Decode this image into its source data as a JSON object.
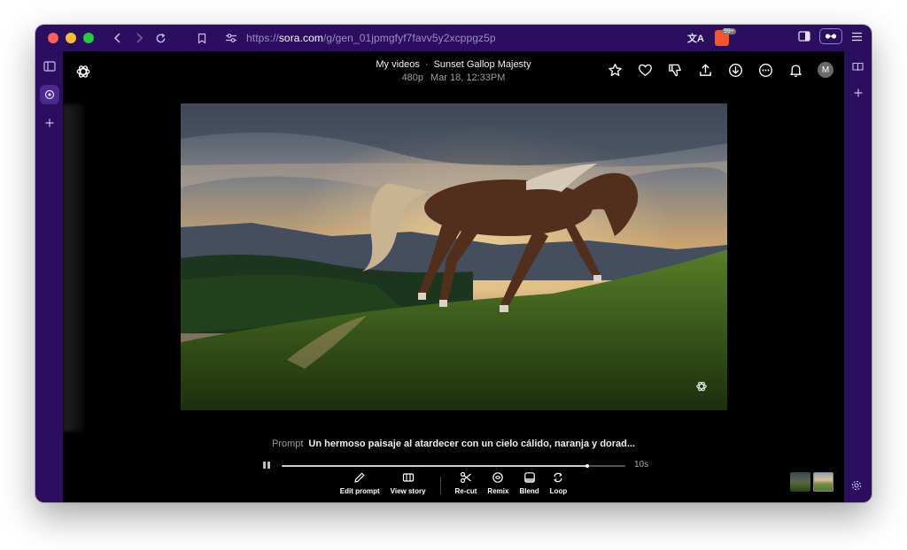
{
  "browser": {
    "url_prefix": "https://",
    "url_host": "sora.com",
    "url_path": "/g/gen_01jpmgfyf7favv5y2xcppgz5p",
    "shield_count": "99+"
  },
  "header": {
    "breadcrumb_parent": "My videos",
    "separator": "·",
    "title": "Sunset Gallop Majesty",
    "resolution": "480p",
    "timestamp": "Mar 18, 12:33PM",
    "avatar_initial": "M"
  },
  "prompt": {
    "label": "Prompt",
    "text": "Un hermoso paisaje al atardecer con un cielo cálido, naranja y dorad..."
  },
  "player": {
    "progress_fraction": 0.89,
    "duration": "10s"
  },
  "tools": [
    {
      "label": "Edit prompt",
      "icon": "pencil-icon"
    },
    {
      "label": "View story",
      "icon": "storyboard-icon"
    },
    {
      "label": "Re-cut",
      "icon": "scissors-icon"
    },
    {
      "label": "Remix",
      "icon": "remix-icon"
    },
    {
      "label": "Blend",
      "icon": "blend-icon"
    },
    {
      "label": "Loop",
      "icon": "loop-icon"
    }
  ],
  "colors": {
    "window_chrome": "#2a0f5e",
    "content_bg": "#000000"
  }
}
